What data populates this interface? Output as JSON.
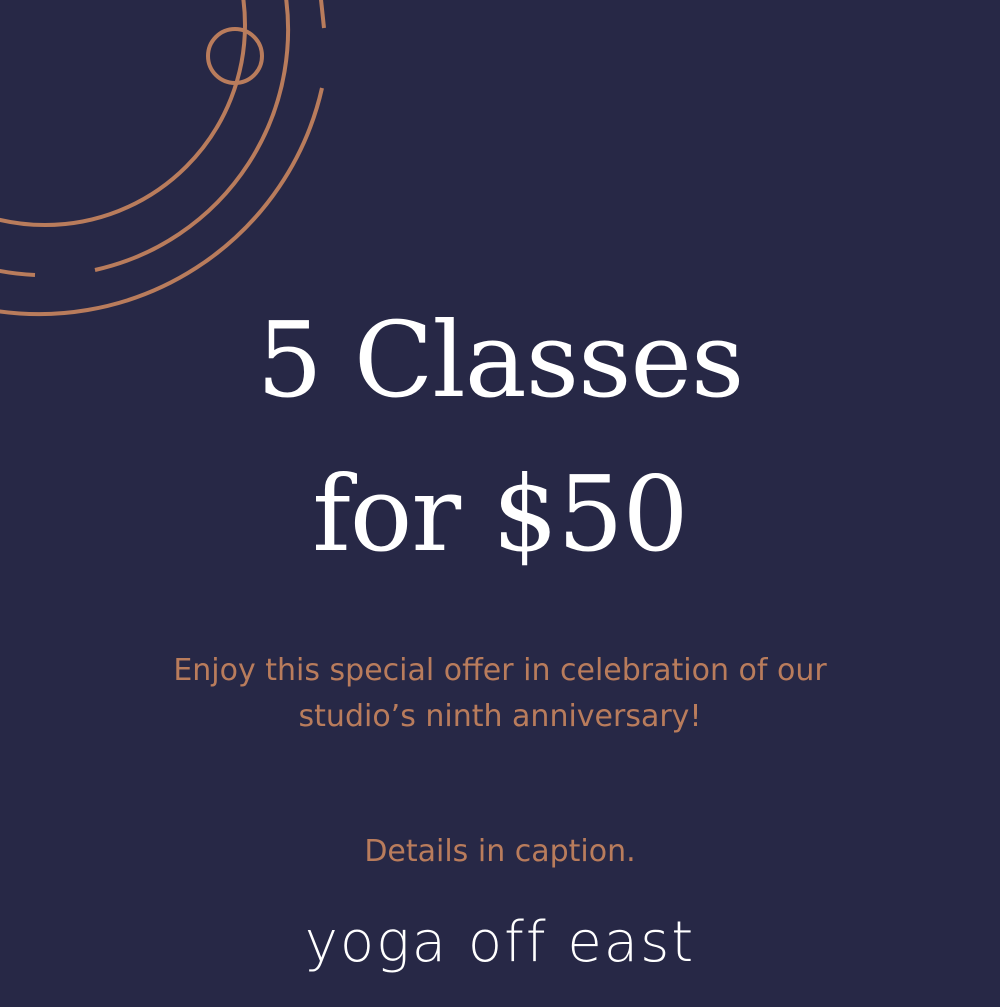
{
  "colors": {
    "background": "#272846",
    "accent": "#b97c5c",
    "text": "#ffffff"
  },
  "headline": {
    "line1": "5 Classes",
    "line2": "for $50"
  },
  "offer": {
    "line1": "Enjoy this special offer in celebration of our",
    "line2": "studio’s ninth anniversary!"
  },
  "details": "Details in caption.",
  "brand": "yoga off east"
}
